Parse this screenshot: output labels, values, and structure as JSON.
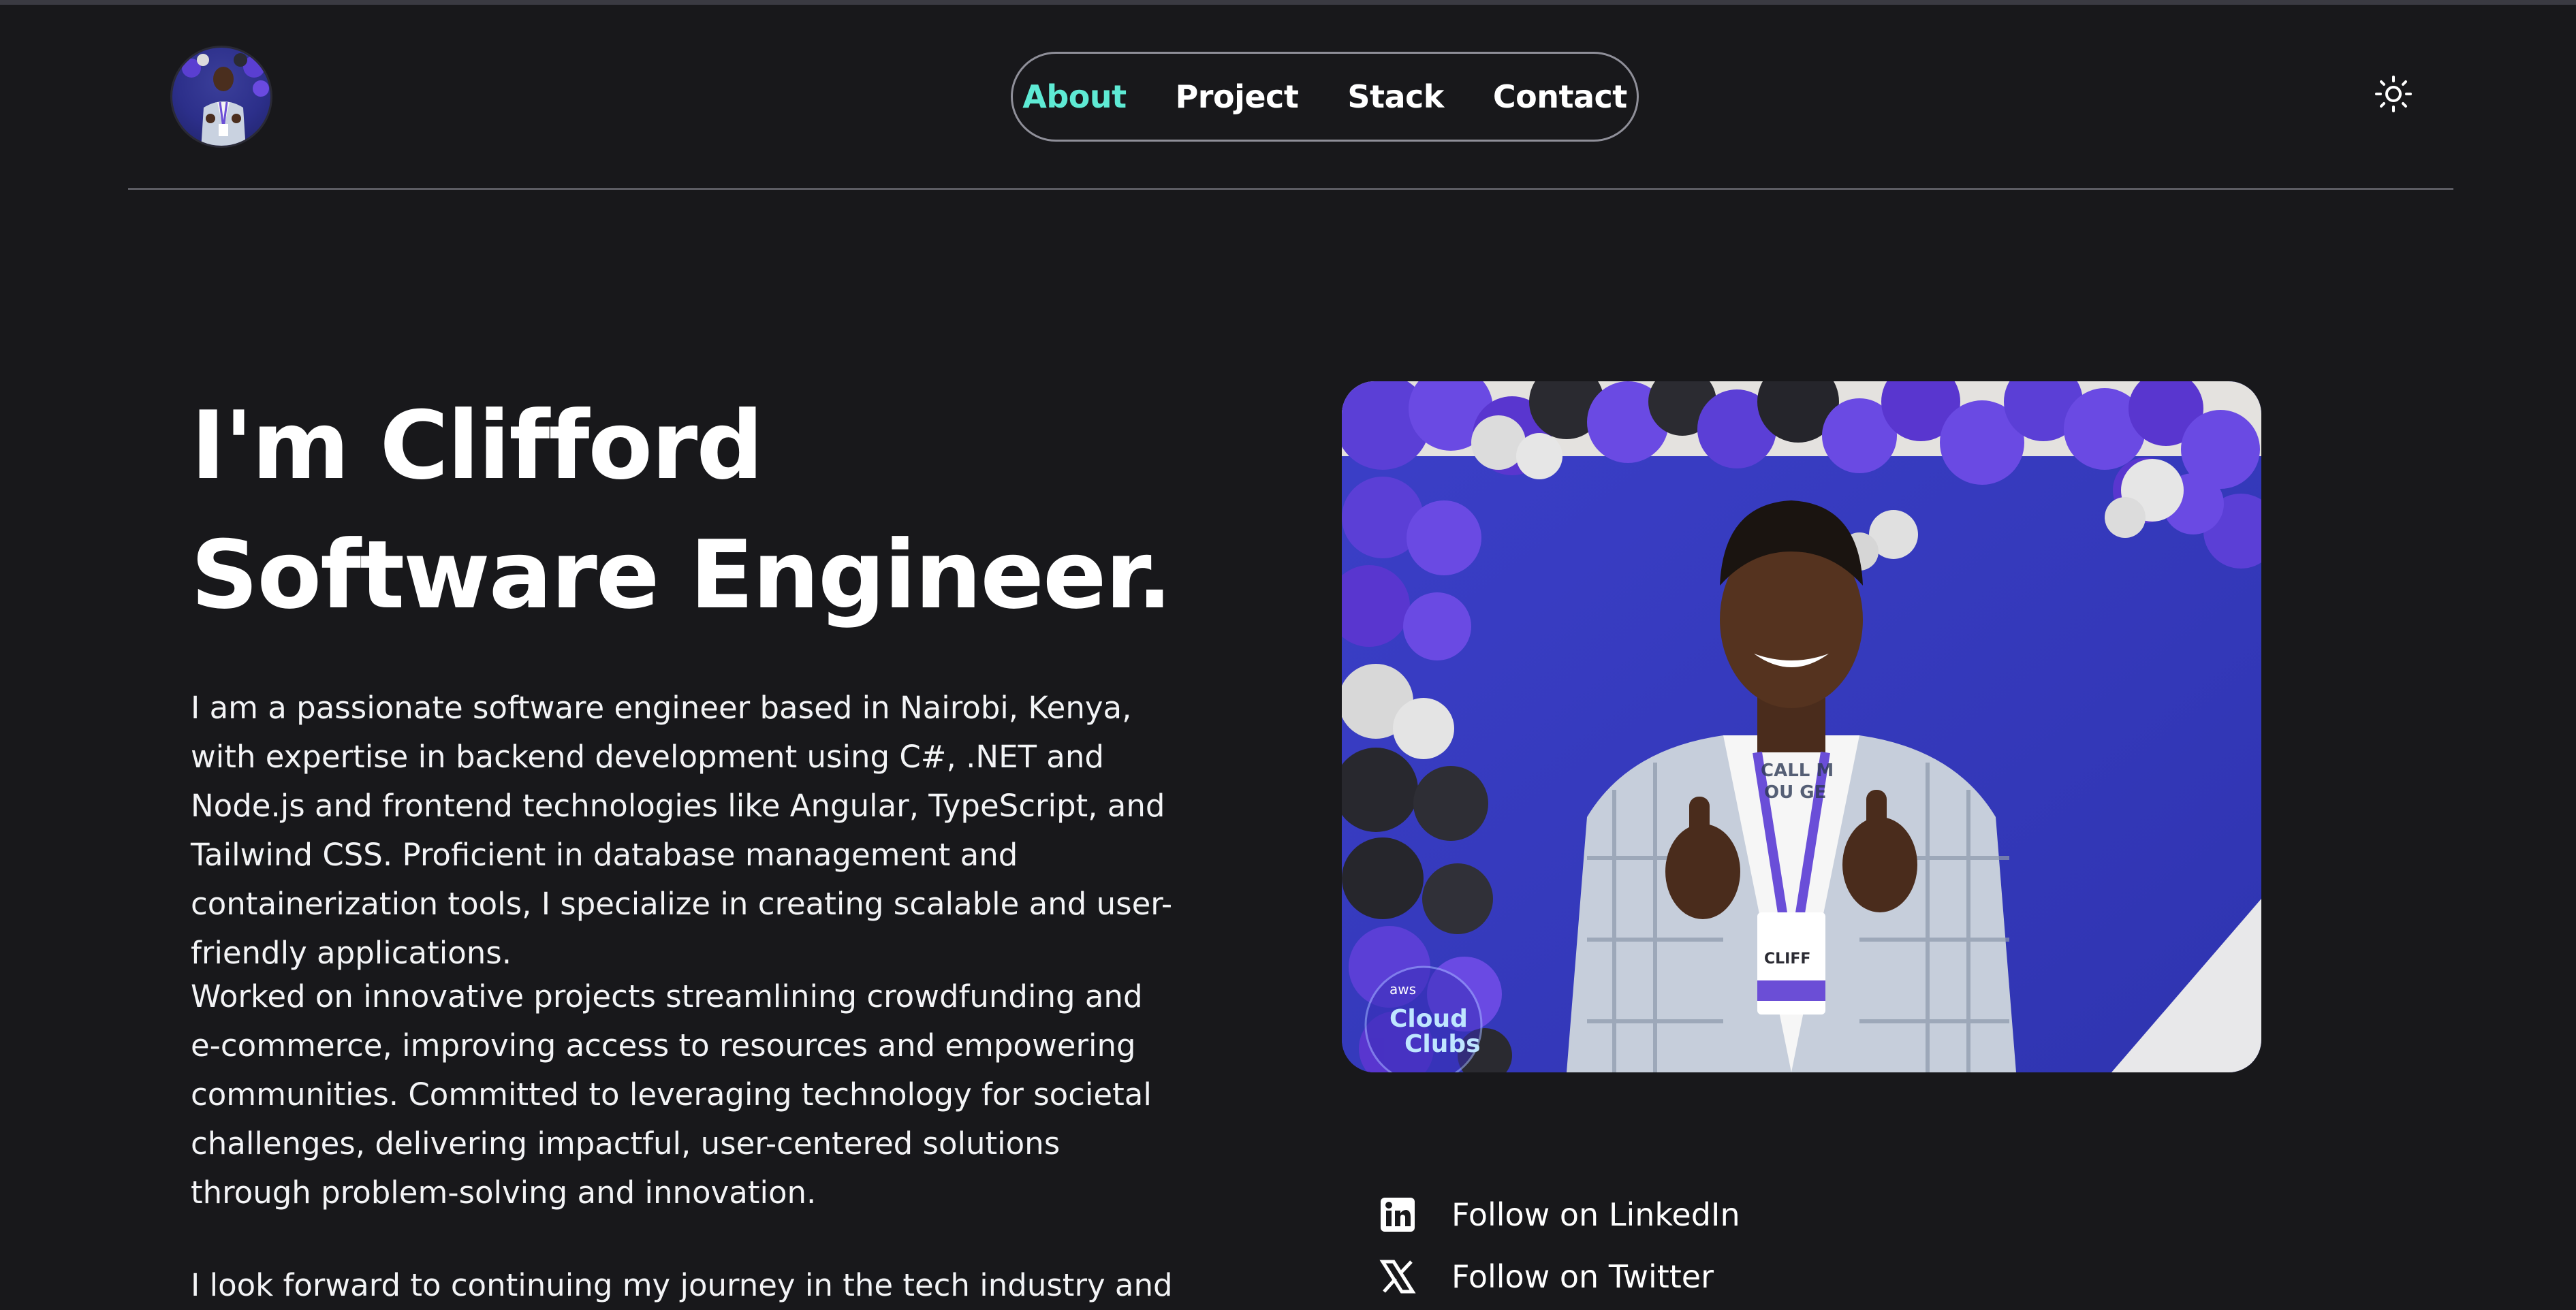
{
  "header": {
    "avatar_alt": "Clifford avatar",
    "nav": [
      {
        "label": "About",
        "active": true
      },
      {
        "label": "Project",
        "active": false
      },
      {
        "label": "Stack",
        "active": false
      },
      {
        "label": "Contact",
        "active": false
      }
    ],
    "theme_toggle_icon": "sun-icon"
  },
  "hero": {
    "title_line1": "I'm Clifford",
    "title_line2": "Software Engineer.",
    "paragraphs": [
      "I am a passionate software engineer based in Nairobi, Kenya, with expertise in backend development using C#, .NET and Node.js and frontend technologies like Angular, TypeScript, and Tailwind CSS. Proficient in database management and containerization tools, I specialize in creating scalable and user-friendly applications.",
      "Worked on innovative projects streamlining crowdfunding and e-commerce, improving access to resources and empowering communities. Committed to leveraging technology for societal challenges, delivering impactful, user-centered solutions through problem-solving and innovation.",
      "I look forward to continuing my journey in the tech industry and"
    ]
  },
  "photo": {
    "badge_small": "aws",
    "badge_line1": "Cloud",
    "badge_line2": "Clubs",
    "shirt_text_1": "CALL M",
    "shirt_text_2": "OU GE",
    "name_tag": "CLIFF"
  },
  "social": [
    {
      "label": "Follow on LinkedIn",
      "icon": "linkedin-icon"
    },
    {
      "label": "Follow on Twitter",
      "icon": "x-twitter-icon"
    }
  ],
  "colors": {
    "background": "#18181b",
    "accent": "#5eead4",
    "text": "#ffffff"
  }
}
